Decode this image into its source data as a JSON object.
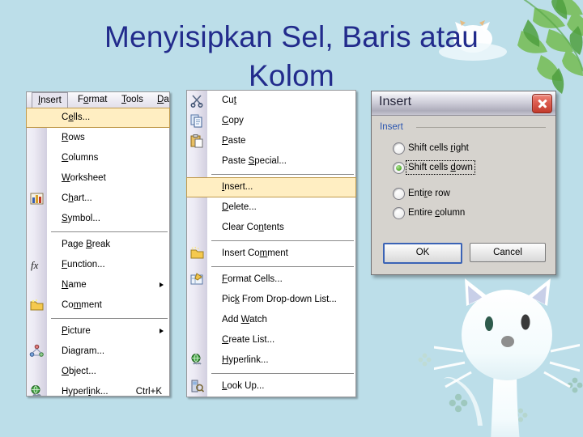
{
  "slide": {
    "title": "Menyisipkan Sel, Baris atau\nKolom",
    "background_color": "#bcdee9",
    "title_color": "#222b8c",
    "decorations": [
      "green-leaves-top-right",
      "white-cat-bottom-right",
      "clover-sparkles"
    ]
  },
  "menubar": {
    "items": [
      {
        "label": "Insert",
        "underline": "I",
        "active": true
      },
      {
        "label": "Format",
        "underline": "o",
        "active": false
      },
      {
        "label": "Tools",
        "underline": "T",
        "active": false
      },
      {
        "label": "Da",
        "underline": "D",
        "active": false
      }
    ]
  },
  "insert_menu": {
    "name": "Insert",
    "items": [
      {
        "label": "Cells...",
        "underline": "e",
        "icon": "",
        "selected": true,
        "accel": "",
        "submenu": false
      },
      {
        "label": "Rows",
        "underline": "R",
        "icon": "",
        "selected": false,
        "accel": "",
        "submenu": false
      },
      {
        "label": "Columns",
        "underline": "C",
        "icon": "",
        "selected": false,
        "accel": "",
        "submenu": false
      },
      {
        "label": "Worksheet",
        "underline": "W",
        "icon": "",
        "selected": false,
        "accel": "",
        "submenu": false
      },
      {
        "label": "Chart...",
        "underline": "h",
        "icon": "chart-icon",
        "selected": false,
        "accel": "",
        "submenu": false
      },
      {
        "label": "Symbol...",
        "underline": "S",
        "icon": "",
        "selected": false,
        "accel": "",
        "submenu": false
      },
      {
        "separator": true
      },
      {
        "label": "Page Break",
        "underline": "B",
        "icon": "",
        "selected": false,
        "accel": "",
        "submenu": false
      },
      {
        "label": "Function...",
        "underline": "F",
        "icon": "function-fx-icon",
        "selected": false,
        "accel": "",
        "submenu": false
      },
      {
        "label": "Name",
        "underline": "N",
        "icon": "",
        "selected": false,
        "accel": "",
        "submenu": true
      },
      {
        "label": "Comment",
        "underline": "m",
        "icon": "comment-note-icon",
        "selected": false,
        "accel": "",
        "submenu": false
      },
      {
        "separator": true
      },
      {
        "label": "Picture",
        "underline": "P",
        "icon": "",
        "selected": false,
        "accel": "",
        "submenu": true
      },
      {
        "label": "Diagram...",
        "underline": "g",
        "icon": "diagram-icon",
        "selected": false,
        "accel": "",
        "submenu": false
      },
      {
        "label": "Object...",
        "underline": "O",
        "icon": "",
        "selected": false,
        "accel": "",
        "submenu": false
      },
      {
        "label": "Hyperlink...",
        "underline": "i",
        "icon": "hyperlink-globe-icon",
        "selected": false,
        "accel": "Ctrl+K",
        "submenu": false
      }
    ]
  },
  "context_menu": {
    "name": "Cell context menu",
    "items": [
      {
        "label": "Cut",
        "underline": "t",
        "icon": "scissors-icon",
        "selected": false,
        "accel": "",
        "submenu": false
      },
      {
        "label": "Copy",
        "underline": "C",
        "icon": "copy-icon",
        "selected": false,
        "accel": "",
        "submenu": false
      },
      {
        "label": "Paste",
        "underline": "P",
        "icon": "paste-icon",
        "selected": false,
        "accel": "",
        "submenu": false
      },
      {
        "label": "Paste Special...",
        "underline": "S",
        "icon": "",
        "selected": false,
        "accel": "",
        "submenu": false
      },
      {
        "separator": true
      },
      {
        "label": "Insert...",
        "underline": "I",
        "icon": "",
        "selected": true,
        "accel": "",
        "submenu": false
      },
      {
        "label": "Delete...",
        "underline": "D",
        "icon": "",
        "selected": false,
        "accel": "",
        "submenu": false
      },
      {
        "label": "Clear Contents",
        "underline": "n",
        "icon": "",
        "selected": false,
        "accel": "",
        "submenu": false
      },
      {
        "separator": true
      },
      {
        "label": "Insert Comment",
        "underline": "m",
        "icon": "insert-comment-icon",
        "selected": false,
        "accel": "",
        "submenu": false
      },
      {
        "separator": true
      },
      {
        "label": "Format Cells...",
        "underline": "F",
        "icon": "format-cells-icon",
        "selected": false,
        "accel": "",
        "submenu": false
      },
      {
        "label": "Pick From Drop-down List...",
        "underline": "k",
        "icon": "",
        "selected": false,
        "accel": "",
        "submenu": false
      },
      {
        "label": "Add Watch",
        "underline": "W",
        "icon": "",
        "selected": false,
        "accel": "",
        "submenu": false
      },
      {
        "label": "Create List...",
        "underline": "C",
        "icon": "",
        "selected": false,
        "accel": "",
        "submenu": false
      },
      {
        "label": "Hyperlink...",
        "underline": "H",
        "icon": "hyperlink-globe-icon",
        "selected": false,
        "accel": "",
        "submenu": false
      },
      {
        "separator": true
      },
      {
        "label": "Look Up...",
        "underline": "L",
        "icon": "lookup-icon",
        "selected": false,
        "accel": "",
        "submenu": false
      }
    ]
  },
  "insert_dialog": {
    "title": "Insert",
    "close_label": "Close",
    "group_label": "Insert",
    "options": [
      {
        "label": "Shift cells right",
        "underline": "r",
        "selected": false,
        "focused": false
      },
      {
        "label": "Shift cells down",
        "underline": "d",
        "selected": true,
        "focused": true
      },
      {
        "label": "Entire row",
        "underline": "r",
        "selected": false,
        "focused": false
      },
      {
        "label": "Entire column",
        "underline": "c",
        "selected": false,
        "focused": false
      }
    ],
    "buttons": [
      {
        "label": "OK",
        "default": true
      },
      {
        "label": "Cancel",
        "default": false
      }
    ]
  }
}
